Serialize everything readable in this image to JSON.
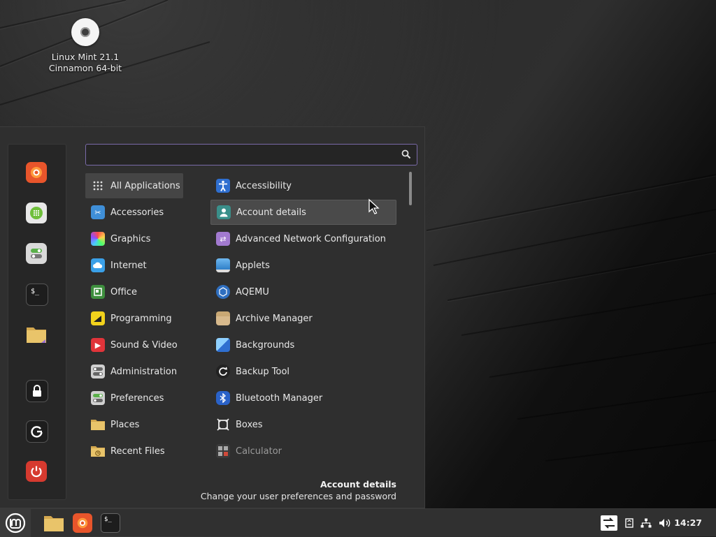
{
  "desktop": {
    "icon_label_line1": "Linux Mint 21.1",
    "icon_label_line2": "Cinnamon 64-bit"
  },
  "menu": {
    "search": {
      "value": "",
      "placeholder": ""
    },
    "favorites": [
      {
        "name": "firefox-icon",
        "color": "#e8552b"
      },
      {
        "name": "software-manager-icon",
        "color": "#6fbf3b"
      },
      {
        "name": "system-settings-icon",
        "color": "#d9d9d9"
      },
      {
        "name": "terminal-icon",
        "label": "$_",
        "color": "#1d1d1d"
      },
      {
        "name": "files-icon",
        "color": "#e6c36a"
      },
      {
        "name": "lock-icon",
        "color": "#1d1d1d"
      },
      {
        "name": "logout-icon",
        "color": "#1d1d1d"
      },
      {
        "name": "power-icon",
        "color": "#d63a2f"
      }
    ],
    "categories": [
      {
        "label": "All Applications",
        "icon": "grid-icon"
      },
      {
        "label": "Accessories",
        "icon": "scissors-icon"
      },
      {
        "label": "Graphics",
        "icon": "graphics-icon"
      },
      {
        "label": "Internet",
        "icon": "cloud-icon"
      },
      {
        "label": "Office",
        "icon": "office-icon"
      },
      {
        "label": "Programming",
        "icon": "programming-icon"
      },
      {
        "label": "Sound & Video",
        "icon": "play-icon"
      },
      {
        "label": "Administration",
        "icon": "administration-icon"
      },
      {
        "label": "Preferences",
        "icon": "preferences-icon"
      },
      {
        "label": "Places",
        "icon": "folder-icon"
      },
      {
        "label": "Recent Files",
        "icon": "recent-folder-icon"
      }
    ],
    "applications": [
      {
        "label": "Accessibility",
        "icon": "accessibility-icon"
      },
      {
        "label": "Account details",
        "icon": "account-icon"
      },
      {
        "label": "Advanced Network Configuration",
        "icon": "network-config-icon"
      },
      {
        "label": "Applets",
        "icon": "applets-icon"
      },
      {
        "label": "AQEMU",
        "icon": "aqemu-icon"
      },
      {
        "label": "Archive Manager",
        "icon": "archive-icon"
      },
      {
        "label": "Backgrounds",
        "icon": "backgrounds-icon"
      },
      {
        "label": "Backup Tool",
        "icon": "backup-icon"
      },
      {
        "label": "Bluetooth Manager",
        "icon": "bluetooth-icon"
      },
      {
        "label": "Boxes",
        "icon": "boxes-icon"
      },
      {
        "label": "Calculator",
        "icon": "calculator-icon"
      }
    ],
    "description": {
      "title": "Account details",
      "text": "Change your user preferences and password"
    }
  },
  "panel": {
    "clock": "14:27",
    "launchers": [
      "files-launcher-icon",
      "firefox-launcher-icon",
      "terminal-launcher-icon"
    ],
    "terminal_label": "$_"
  }
}
